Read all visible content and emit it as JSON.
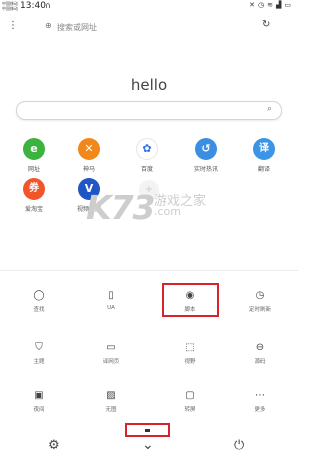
{
  "status_bar": {
    "carrier_1": "中国移动",
    "carrier_2": "中国移动",
    "time": "13:40",
    "icons": [
      "headphones-icon",
      "signal-icon",
      "wifi-icon",
      "battery-icon"
    ]
  },
  "top_bar": {
    "search_placeholder": "搜索或网址"
  },
  "home": {
    "greeting": "hello"
  },
  "shortcuts": [
    {
      "label": "网址",
      "glyph": "e",
      "color": "#3cb33e"
    },
    {
      "label": "神马",
      "glyph": "✕",
      "color": "#f0891a"
    },
    {
      "label": "百度",
      "glyph": "✿",
      "color": "#2f6fe8"
    },
    {
      "label": "实时热讯",
      "glyph": "↺",
      "color": "#3b8fe2"
    },
    {
      "label": "翻译",
      "glyph": "译",
      "color": "#3c94e6"
    },
    {
      "label": "爱淘宝",
      "glyph": "券",
      "color": "#f1562a"
    },
    {
      "label": "视频播放",
      "glyph": "V",
      "color": "#1f55c5"
    }
  ],
  "watermark": {
    "brand": "K73",
    "cn": "游戏之家",
    "com": ".com"
  },
  "menu": [
    {
      "label": "查找",
      "icon": "◯"
    },
    {
      "label": "UA",
      "icon": "▯"
    },
    {
      "label": "脚本",
      "icon": "◉"
    },
    {
      "label": "定时刷新",
      "icon": "◷"
    },
    {
      "label": "主题",
      "icon": "⛉"
    },
    {
      "label": "译网页",
      "icon": "▭"
    },
    {
      "label": "视野",
      "icon": "⬚"
    },
    {
      "label": "源码",
      "icon": "⊖"
    },
    {
      "label": "夜间",
      "icon": "▣"
    },
    {
      "label": "无图",
      "icon": "▨"
    },
    {
      "label": "转屏",
      "icon": "▢"
    },
    {
      "label": "更多",
      "icon": "⋯"
    }
  ],
  "colors": {
    "highlight": "#d8232a"
  }
}
